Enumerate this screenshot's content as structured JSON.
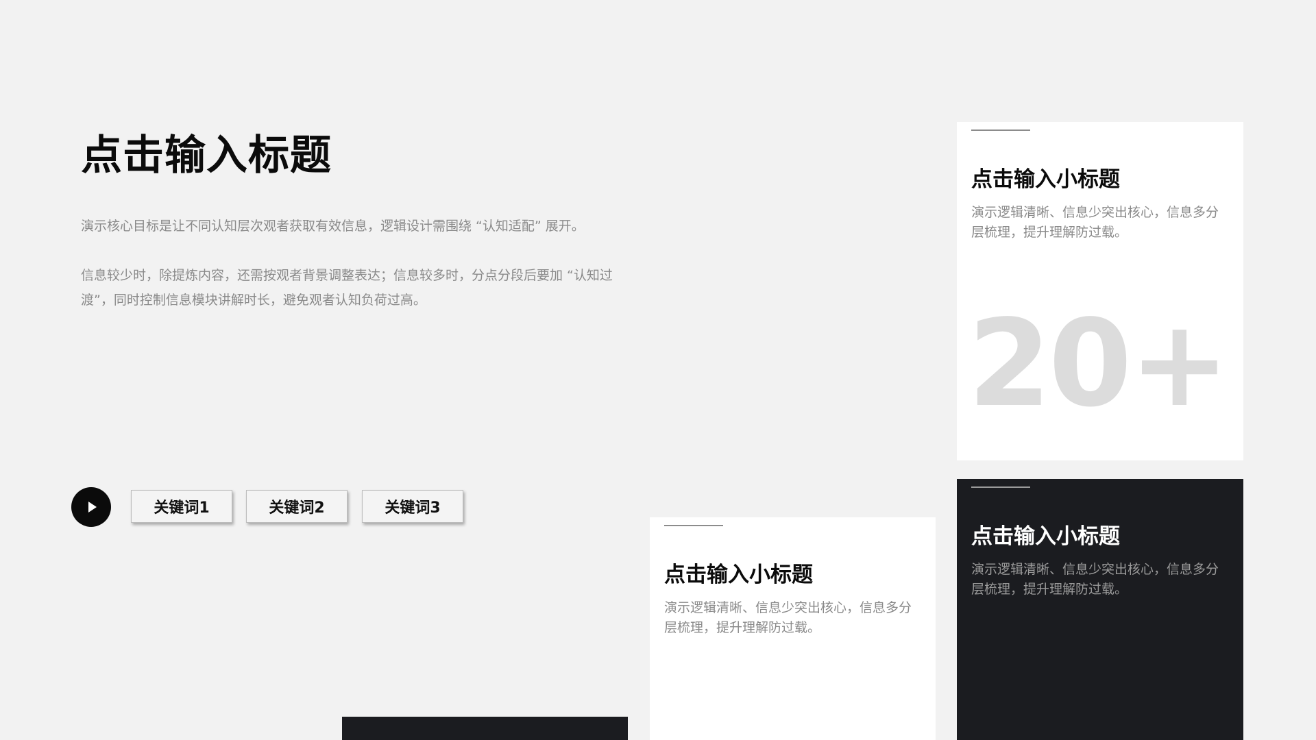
{
  "main": {
    "title": "点击输入标题",
    "paragraph_1": "演示核心目标是让不同认知层次观者获取有效信息，逻辑设计需围绕 “认知适配” 展开。",
    "paragraph_2": "信息较少时，除提炼内容，还需按观者背景调整表达；信息较多时，分点分段后要加 “认知过渡”，同时控制信息模块讲解时长，避免观者认知负荷过高。"
  },
  "keywords": [
    {
      "label": "关键词1"
    },
    {
      "label": "关键词2"
    },
    {
      "label": "关键词3"
    }
  ],
  "cards": {
    "top_right": {
      "title": "点击输入小标题",
      "body": "演示逻辑清晰、信息少突出核心，信息多分层梳理，提升理解防过载。",
      "stat": "20+"
    },
    "bottom_right": {
      "title": "点击输入小标题",
      "body": "演示逻辑清晰、信息少突出核心，信息多分层梳理，提升理解防过载。"
    },
    "bottom_mid": {
      "title": "点击输入小标题",
      "body": "演示逻辑清晰、信息少突出核心，信息多分层梳理，提升理解防过载。"
    }
  },
  "colors": {
    "background": "#f2f2f2",
    "dark_card": "#1b1c20",
    "text_primary": "#0b0b0b",
    "text_secondary": "#8a8a8a",
    "stat_number": "#dcdcdc"
  },
  "icons": {
    "play": "play-icon"
  }
}
